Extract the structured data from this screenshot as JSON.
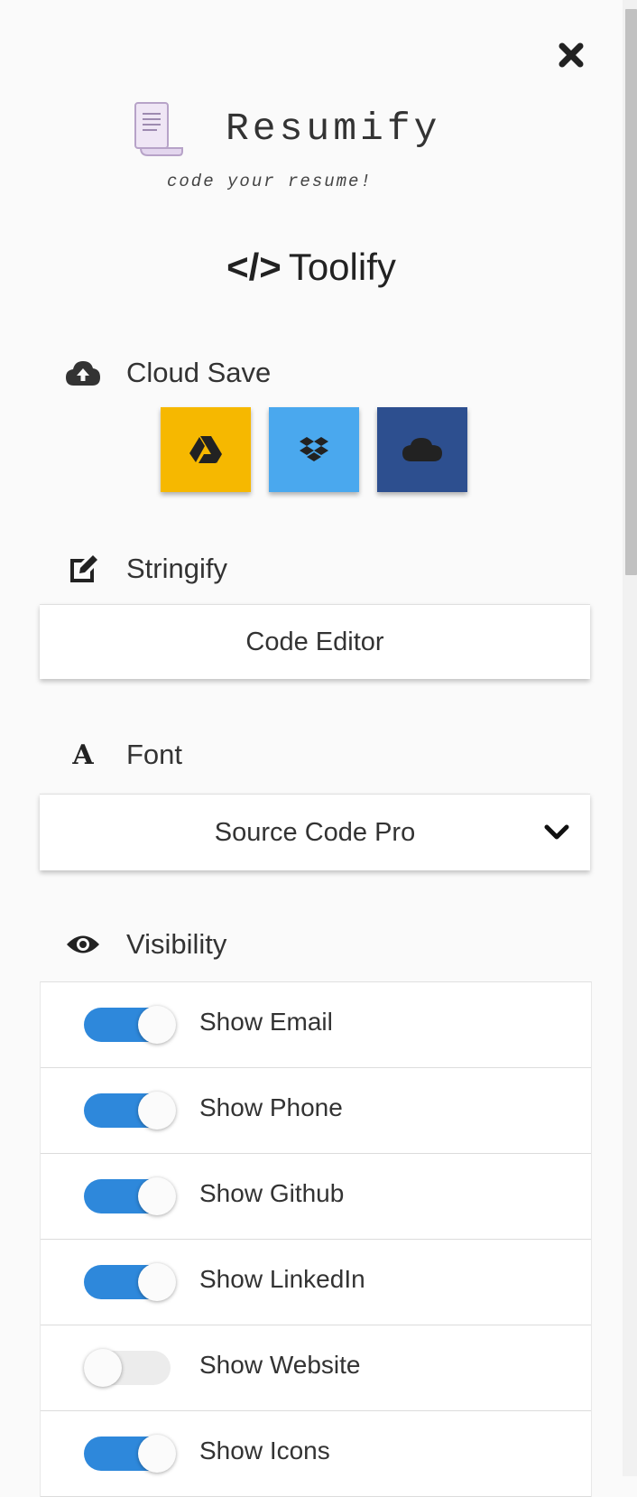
{
  "header": {
    "close_icon": "close-x-icon",
    "brand": {
      "title": "Resumify",
      "tagline": "code your resume!",
      "logo_icon": "scroll-document-icon"
    },
    "toolify_icon": "code-brackets-icon",
    "toolify_title": "Toolify"
  },
  "cloud_save": {
    "label": "Cloud Save",
    "icon": "cloud-upload-icon",
    "buttons": [
      {
        "name": "google-drive",
        "icon": "google-drive-icon",
        "color": "#f6b800"
      },
      {
        "name": "dropbox",
        "icon": "dropbox-icon",
        "color": "#4aa8ee"
      },
      {
        "name": "onedrive",
        "icon": "cloud-icon",
        "color": "#2d4f8f"
      }
    ]
  },
  "stringify": {
    "label": "Stringify",
    "icon": "edit-icon",
    "button_label": "Code Editor"
  },
  "font": {
    "label": "Font",
    "icon": "font-icon",
    "selected": "Source Code Pro"
  },
  "visibility": {
    "label": "Visibility",
    "icon": "eye-icon",
    "items": [
      {
        "label": "Show Email",
        "on": true
      },
      {
        "label": "Show Phone",
        "on": true
      },
      {
        "label": "Show Github",
        "on": true
      },
      {
        "label": "Show LinkedIn",
        "on": true
      },
      {
        "label": "Show Website",
        "on": false
      },
      {
        "label": "Show Icons",
        "on": true
      }
    ]
  },
  "colors": {
    "toggle_on": "#2e88db",
    "toggle_off": "#ececec",
    "background": "#fafafa"
  }
}
